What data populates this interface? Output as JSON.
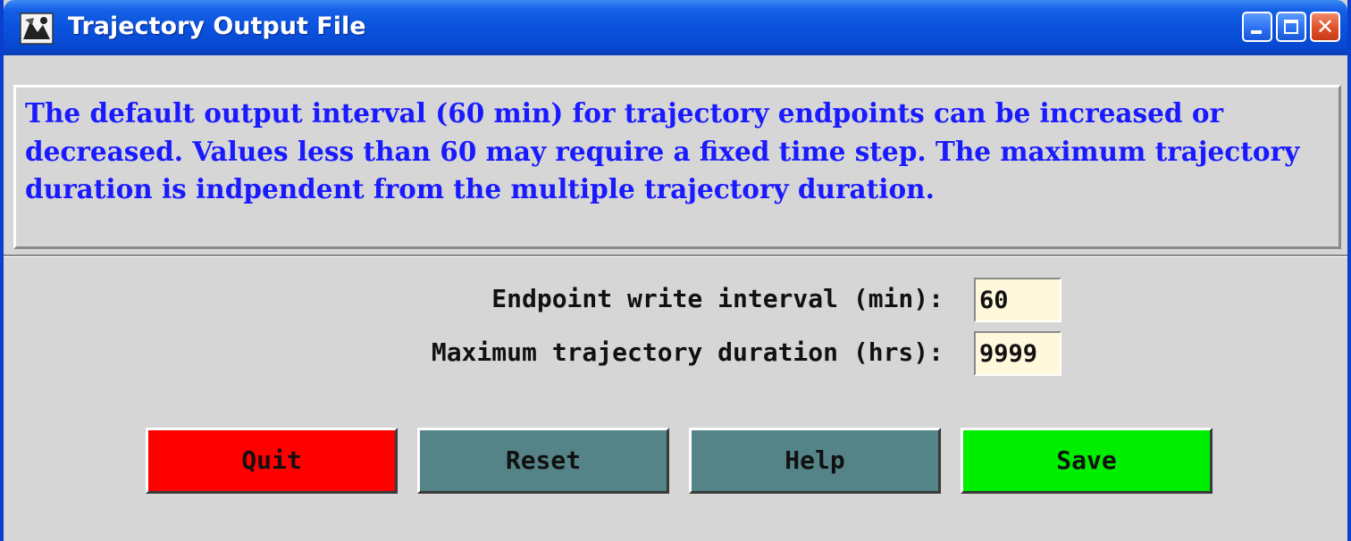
{
  "window": {
    "title": "Trajectory Output File",
    "icon": "app-icon"
  },
  "titlebar_buttons": {
    "minimize_icon": "minimize-icon",
    "maximize_icon": "maximize-icon",
    "close_icon": "close-icon",
    "close_glyph": "✕"
  },
  "info": {
    "text": "The default output interval (60 min) for trajectory endpoints can be increased or decreased. Values less than 60 may require a fixed time step. The maximum trajectory duration is indpendent from the multiple trajectory duration."
  },
  "form": {
    "interval_label": "Endpoint write interval (min):",
    "interval_value": "60",
    "duration_label": "Maximum trajectory duration (hrs):",
    "duration_value": "9999"
  },
  "buttons": {
    "quit": "Quit",
    "reset": "Reset",
    "help": "Help",
    "save": "Save"
  },
  "colors": {
    "info_text": "#1a1aff",
    "quit_bg": "#ff0000",
    "reset_bg": "#548487",
    "help_bg": "#548487",
    "save_bg": "#00ee00",
    "input_bg": "#fff8dc",
    "titlebar": "#0a52de"
  }
}
